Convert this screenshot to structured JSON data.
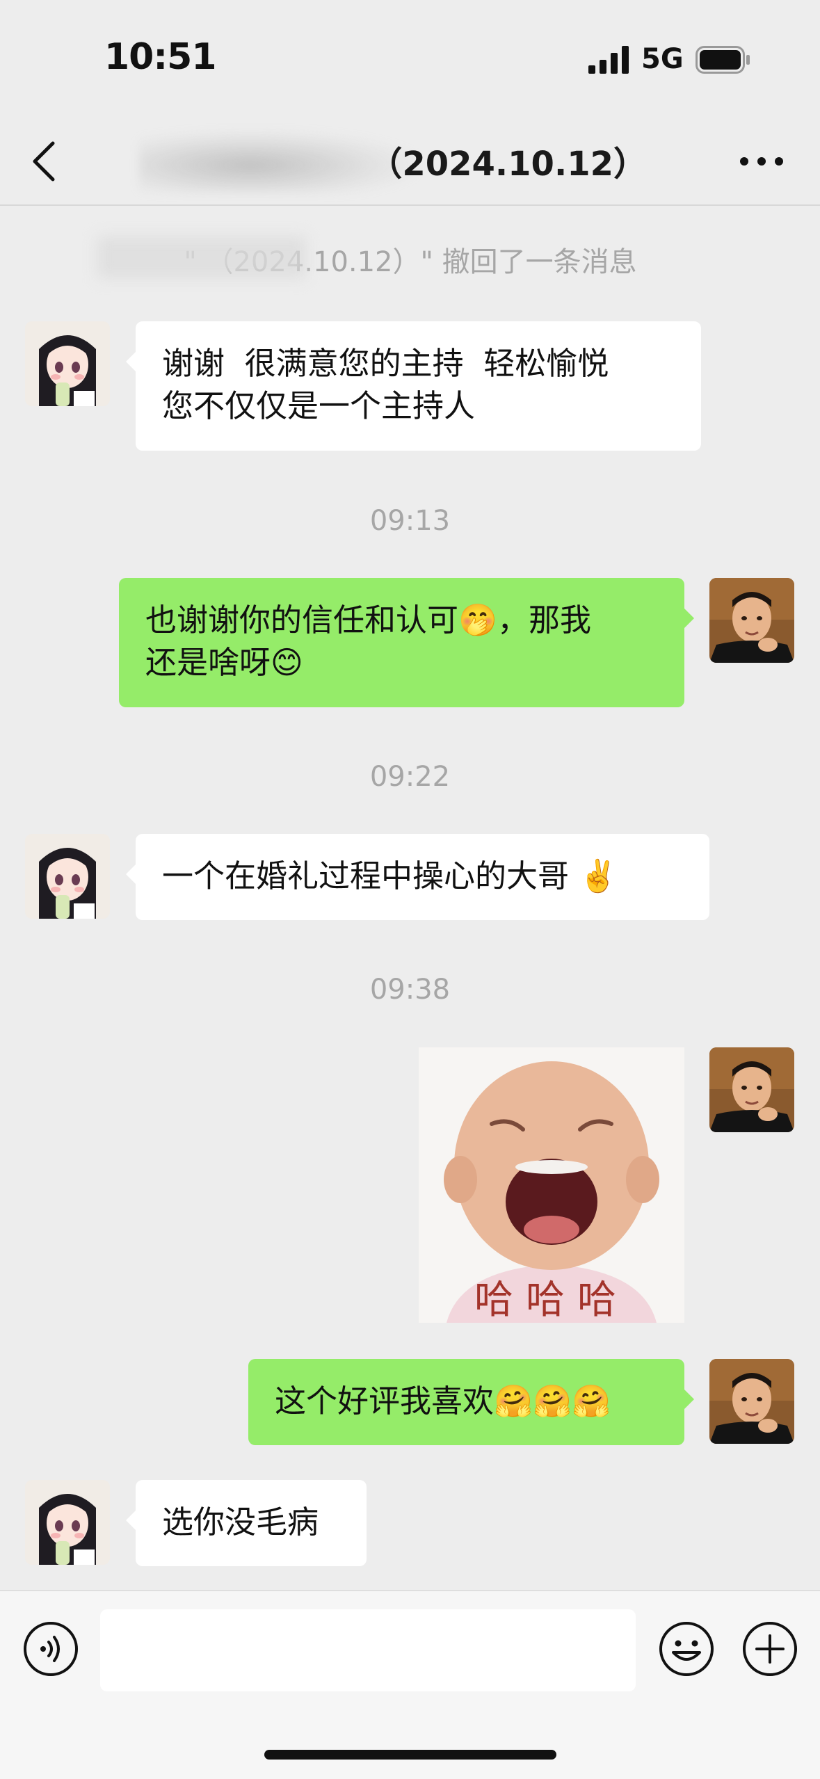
{
  "status_bar": {
    "time": "10:51",
    "network": "5G"
  },
  "nav": {
    "title": "（2024.10.12）"
  },
  "messages": {
    "recall_notice": "\"              （2024.10.12）\" 撤回了一条消息",
    "msg1": {
      "text": "谢谢  很满意您的主持  轻松愉悦\n您不仅仅是一个主持人"
    },
    "time1": "09:13",
    "msg2": {
      "text": "也谢谢你的信任和认可🤭，那我\n还是啥呀😊"
    },
    "time2": "09:22",
    "msg3": {
      "text": "一个在婚礼过程中操心的大哥 ✌️"
    },
    "time3": "09:38",
    "sticker": {
      "caption": "哈哈哈"
    },
    "msg4": {
      "text": "这个好评我喜欢🤗🤗🤗"
    },
    "msg5": {
      "text": "选你没毛病"
    }
  },
  "input_bar": {
    "placeholder": ""
  },
  "colors": {
    "outgoing_bubble": "#95ec69",
    "incoming_bubble": "#ffffff",
    "background": "#ededed"
  }
}
